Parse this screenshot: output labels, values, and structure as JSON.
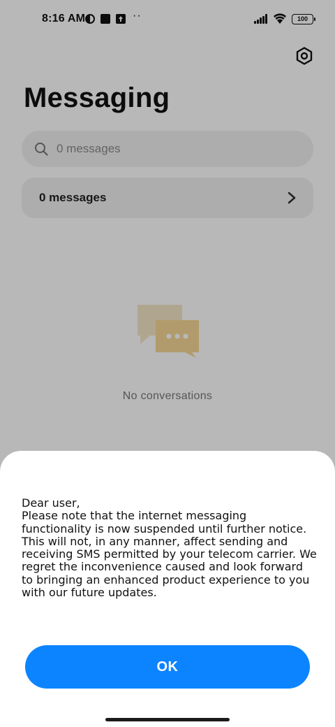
{
  "status_bar": {
    "time": "8:16 AM",
    "battery": "100",
    "dots": "··"
  },
  "header": {
    "title": "Messaging",
    "settings_icon": "gear-icon"
  },
  "search": {
    "placeholder": "0 messages",
    "icon": "search-icon"
  },
  "messages_row": {
    "label": "0 messages",
    "icon": "chevron-right-icon"
  },
  "empty_state": {
    "text": "No conversations",
    "icon": "chat-bubbles-icon"
  },
  "dialog": {
    "greeting": "Dear user,",
    "body": "Please note that the internet messaging functionality is now suspended until further notice. This will not, in any manner, affect sending and receiving SMS permitted by your telecom carrier. We regret the inconvenience caused and look forward to bringing an enhanced product experience to you with our future updates.",
    "ok_label": "OK"
  },
  "colors": {
    "accent": "#0d84ff",
    "surface": "#f0f0f0",
    "illustration_back": "#f4e7c8",
    "illustration_front": "#f6d796"
  }
}
